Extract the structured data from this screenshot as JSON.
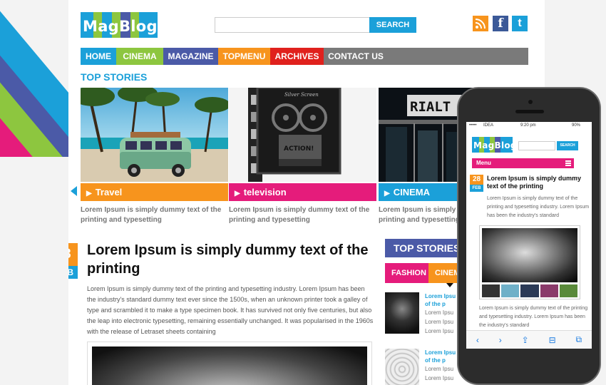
{
  "brand": {
    "logo": "MagBlog"
  },
  "search": {
    "placeholder": "",
    "button": "SEARCH"
  },
  "social": {
    "rss_icon": "rss-icon",
    "facebook_icon": "facebook-icon",
    "twitter_icon": "twitter-icon",
    "facebook_glyph": "f",
    "twitter_glyph": "t"
  },
  "nav": {
    "items": [
      "HOME",
      "CINEMA",
      "MAGAZINE",
      "TOPMENU",
      "ARCHIVES",
      "CONTACT US"
    ]
  },
  "top_stories": {
    "title": "TOP STORIES",
    "cards": [
      {
        "category": "Travel",
        "desc": "Lorem Ipsum is simply dummy text of the printing and typesetting"
      },
      {
        "category": "television",
        "desc": "Lorem Ipsum is simply dummy text of the printing and typesetting"
      },
      {
        "category": "CINEMA",
        "desc": "Lorem Ipsum is simply dummy text of the printing and typesetting"
      }
    ],
    "photo_text": {
      "screen_sign": "Silver Screen",
      "action_sign": "ACTION!",
      "theater_sign": "RIALT"
    }
  },
  "post": {
    "day": "28",
    "month": "FEB",
    "title": "Lorem Ipsum is simply dummy text of the printing",
    "body": "Lorem Ipsum is simply dummy text of the printing and typesetting industry. Lorem Ipsum has been the industry's standard dummy text ever since the 1500s, when an unknown printer took a galley of type and scrambled it to make a type specimen book. It has survived not only five centuries, but also the leap into electronic typesetting, remaining essentially unchanged. It was popularised in the 1960s with the release of Letraset sheets containing"
  },
  "sidebar": {
    "title": "TOP STORIES",
    "tabs": [
      "FASHION",
      "CINEMA"
    ],
    "items": [
      {
        "title": "Lorem Ipsu",
        "title2": "of the p",
        "lines": [
          "Lorem Ipsu",
          "Lorem Ipsu",
          "Lorem Ipsu"
        ]
      },
      {
        "title": "Lorem Ipsu",
        "title2": "of the p",
        "lines": [
          "Lorem Ipsu",
          "Lorem Ipsu"
        ]
      }
    ]
  },
  "phone": {
    "carrier": "IDEA",
    "time": "9:20 pm",
    "battery": "90%",
    "logo": "MagBlog",
    "search_button": "SEARCH",
    "menu": "Menu",
    "day": "28",
    "month": "FEB",
    "title": "Lorem Ipsum is simply dummy text of the printing",
    "body": "Lorem Ipsum is simply dummy text of the printing and typesetting industry. Lorem Ipsum has been the industry's standard",
    "body2": "Lorem Ipsum is simply dummy text of the printing and typesetting industry. Lorem Ipsum has been the industry's standard",
    "toolbar": {
      "back": "‹",
      "forward": "›",
      "share": "⇪",
      "bookmarks": "⊟",
      "tabs": "⧉"
    }
  },
  "colors": {
    "blue": "#1ba0d9",
    "green": "#8dc63f",
    "purple": "#4b5aa7",
    "orange": "#f7941d",
    "red": "#e0211d",
    "pink": "#e51c7b",
    "gray": "#7a7a7a"
  }
}
